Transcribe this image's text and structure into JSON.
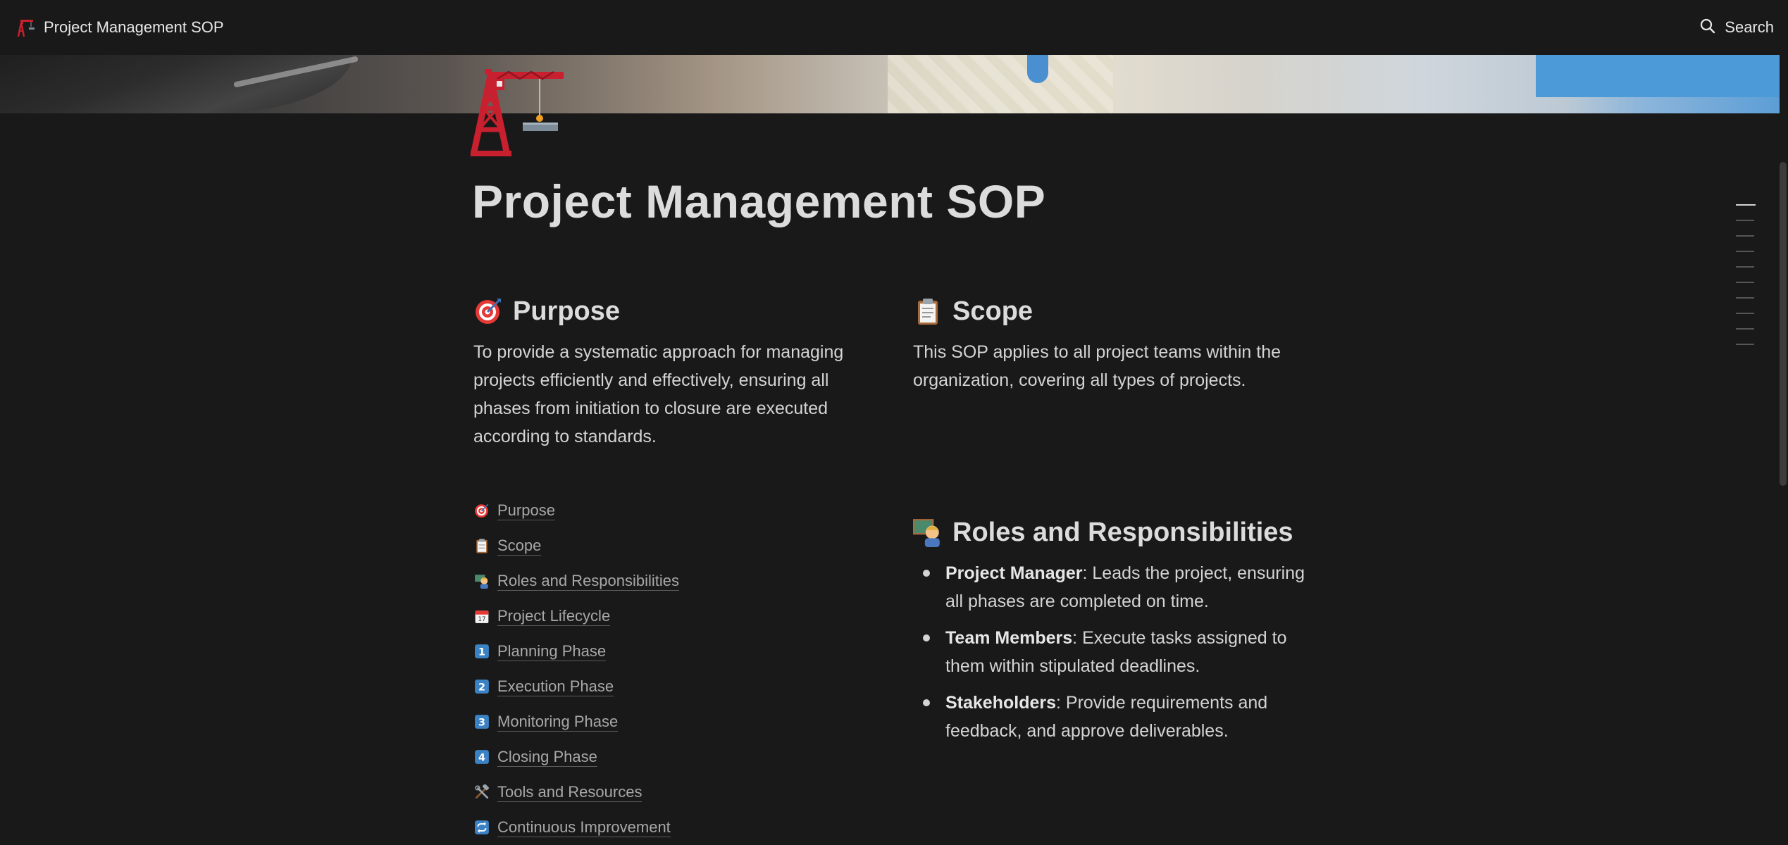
{
  "topbar": {
    "title": "Project Management SOP",
    "search_label": "Search"
  },
  "page": {
    "title": "Project Management SOP",
    "icon": "construction-crane-icon"
  },
  "purpose": {
    "heading": "Purpose",
    "icon": "direct-hit-target-icon",
    "text": "To provide a systematic approach for managing projects efficiently and effectively, ensuring all phases from initiation to closure are executed according to standards."
  },
  "scope": {
    "heading": "Scope",
    "icon": "clipboard-icon",
    "text": "This SOP applies to all project teams within the organization, covering all types of projects."
  },
  "toc": [
    {
      "label": "Purpose",
      "icon": "direct-hit-target-icon"
    },
    {
      "label": "Scope",
      "icon": "clipboard-icon"
    },
    {
      "label": "Roles and Responsibilities",
      "icon": "teacher-icon"
    },
    {
      "label": "Project Lifecycle",
      "icon": "calendar-icon"
    },
    {
      "label": "Planning Phase",
      "icon": "keycap-1-icon"
    },
    {
      "label": "Execution Phase",
      "icon": "keycap-2-icon"
    },
    {
      "label": "Monitoring Phase",
      "icon": "keycap-3-icon"
    },
    {
      "label": "Closing Phase",
      "icon": "keycap-4-icon"
    },
    {
      "label": "Tools and Resources",
      "icon": "hammer-and-wrench-icon"
    },
    {
      "label": "Continuous Improvement",
      "icon": "repeat-arrows-icon"
    }
  ],
  "roles": {
    "heading": "Roles and Responsibilities",
    "icon": "teacher-icon",
    "items": [
      {
        "role": "Project Manager",
        "desc": ": Leads the project, ensuring all phases are completed on time."
      },
      {
        "role": "Team Members",
        "desc": ": Execute tasks assigned to them within stipulated deadlines."
      },
      {
        "role": "Stakeholders",
        "desc": ": Provide requirements and feedback, and approve deliverables."
      }
    ]
  },
  "colors": {
    "background": "#191919",
    "text": "#d4d4d4",
    "muted_link": "#a8a8a8",
    "crane_red": "#c8202e"
  }
}
